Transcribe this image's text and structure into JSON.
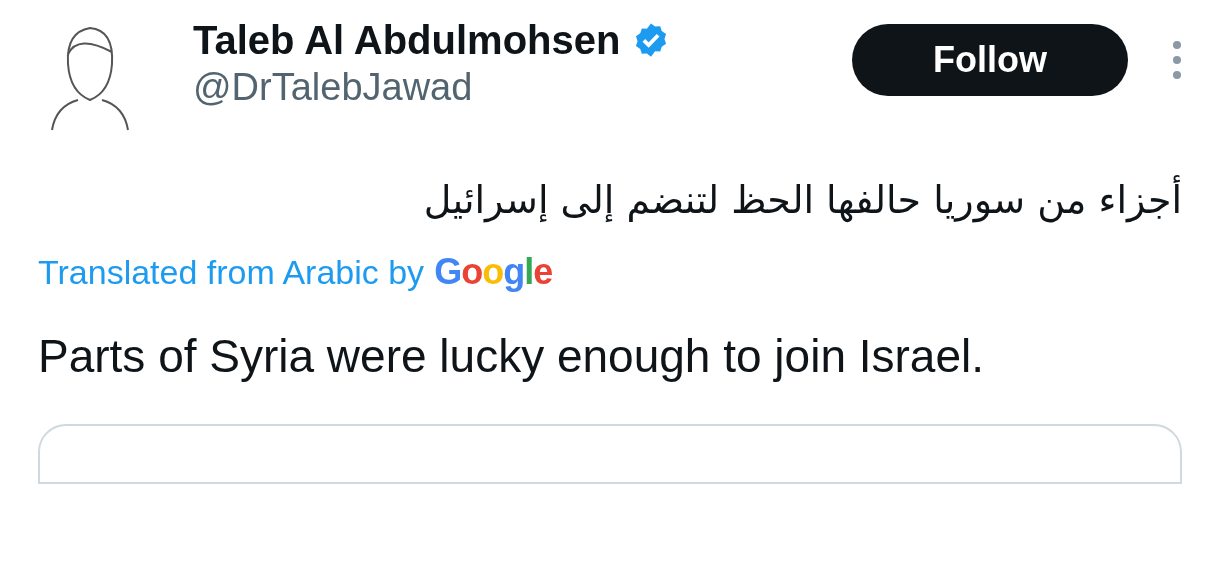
{
  "author": {
    "name": "Taleb Al Abdulmohsen",
    "handle": "@DrTalebJawad",
    "verified": true
  },
  "follow_button": {
    "label": "Follow"
  },
  "tweet": {
    "text": "أجزاء من سوريا حالفها الحظ لتنضم إلى إسرائيل",
    "translation_note": "Translated from Arabic by",
    "translation_provider": "Google",
    "translation": "Parts of Syria were lucky enough to join Israel."
  }
}
